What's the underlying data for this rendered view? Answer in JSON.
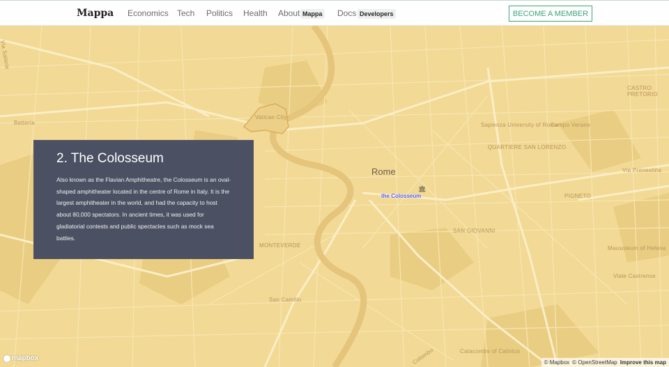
{
  "nav": {
    "brand": "Mappa",
    "links": [
      "Economics",
      "Tech",
      "Politics",
      "Health",
      "About",
      "Docs"
    ],
    "about_badge": "Mappa",
    "docs_badge": "Developers",
    "cta": "BECOME A MEMBER"
  },
  "map": {
    "city": "Rome",
    "poi": "the Colosseum",
    "poi_icon": "museum-icon",
    "areas": [
      "Sapienza University of Rome",
      "Campo Verano",
      "QUARTIERE SAN LORENZO",
      "PIGNETO",
      "Via Prenestina",
      "Mausoleum of Helena",
      "MONTEVERDE",
      "San Camillo",
      "Catacombs of Calixtus",
      "SAN GIOVANNI",
      "CASTRO PRETORIO",
      "Via Salaria",
      "Viale Castrense",
      "Colombo",
      "Batteria",
      "Vatican City"
    ],
    "colors": {
      "land": "#f2d995",
      "road": "#f9e7b4",
      "major_road": "#fbedc4",
      "river": "#e5c47c",
      "park": "#e9cd82"
    }
  },
  "card": {
    "title": "2. The Colosseum",
    "body": "Also known as the Flavian Amphitheatre, the Colosseum is an oval-shaped amphitheater located in the centre of Rome in Italy. It is the largest amphitheater in the world, and had the capacity to host about 80,000 spectators. In ancient times, it was used for gladiatorial contests and public spectacles such as mock sea battles."
  },
  "footer": {
    "logo": "mapbox",
    "attrib_mapbox": "© Mapbox",
    "attrib_osm": "© OpenStreetMap",
    "improve": "Improve this map"
  }
}
